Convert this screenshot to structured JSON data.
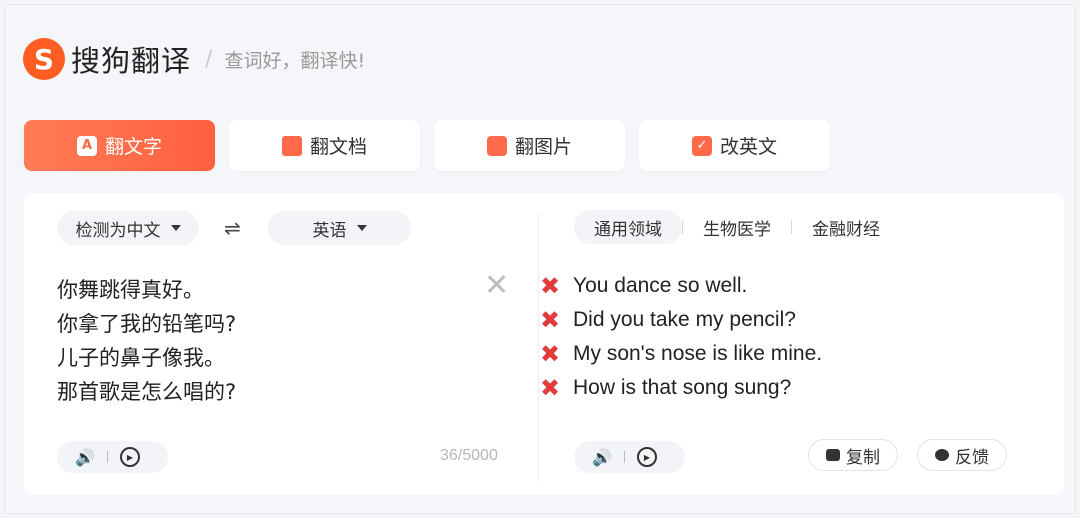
{
  "header": {
    "logo_glyph": "S",
    "logo_text": "搜狗翻译",
    "separator": "/",
    "slogan": "查词好，翻译快!"
  },
  "tabs": [
    {
      "label": "翻文字",
      "icon": "text-translate-icon",
      "active": true
    },
    {
      "label": "翻文档",
      "icon": "document-icon",
      "active": false
    },
    {
      "label": "翻图片",
      "icon": "image-icon",
      "active": false
    },
    {
      "label": "改英文",
      "icon": "edit-english-icon",
      "active": false
    }
  ],
  "source": {
    "language": "检测为中文",
    "swap_glyph": "⇌",
    "target_language": "英语",
    "lines": [
      "你舞跳得真好。",
      "你拿了我的铅笔吗?",
      "儿子的鼻子像我。",
      "那首歌是怎么唱的?"
    ],
    "char_count": "36/5000"
  },
  "domains": [
    "通用领域",
    "生物医学",
    "金融财经"
  ],
  "target": {
    "lines": [
      "You dance so well.",
      "Did you take my pencil?",
      "My son's nose is like mine.",
      "How is that song sung?"
    ],
    "copy_label": "复制",
    "feedback_label": "反馈"
  },
  "colors": {
    "accent": "#ff5f3f",
    "error_mark": "#e23b3b"
  }
}
